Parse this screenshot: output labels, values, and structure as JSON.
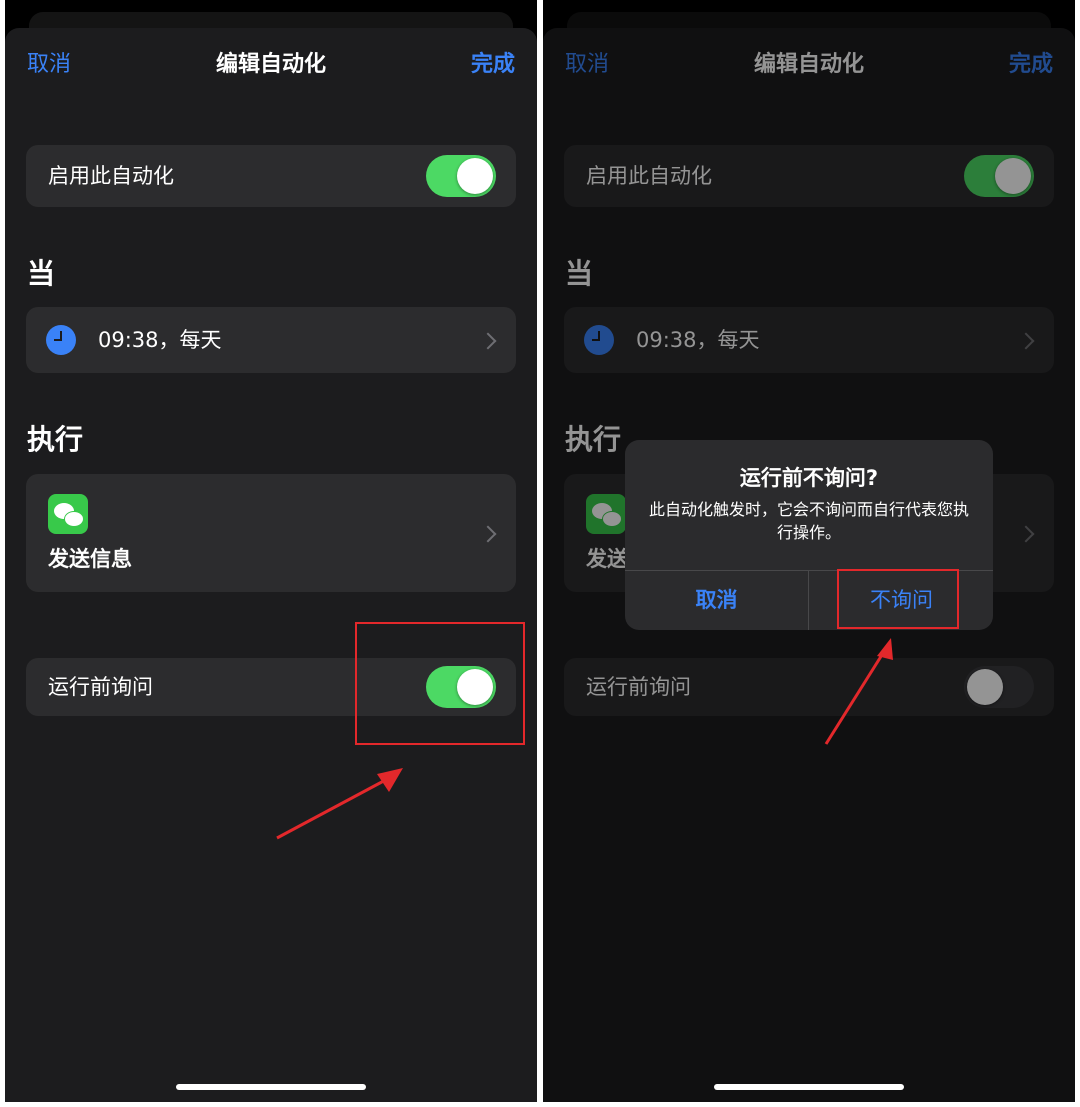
{
  "left_screen": {
    "nav": {
      "cancel": "取消",
      "title": "编辑自动化",
      "done": "完成"
    },
    "enable_row": {
      "label": "启用此自动化",
      "toggle_on": true
    },
    "when_section": {
      "header": "当",
      "trigger_text": "09:38，每天"
    },
    "do_section": {
      "header": "执行",
      "action_label": "发送信息",
      "app_icon": "wechat-icon"
    },
    "ask_row": {
      "label": "运行前询问",
      "toggle_on": true
    }
  },
  "right_screen": {
    "nav": {
      "cancel": "取消",
      "title": "编辑自动化",
      "done": "完成"
    },
    "enable_row": {
      "label": "启用此自动化",
      "toggle_on": true
    },
    "when_section": {
      "header": "当",
      "trigger_text": "09:38，每天"
    },
    "do_section": {
      "header": "执行",
      "action_label": "发送信息",
      "app_icon": "wechat-icon"
    },
    "ask_row": {
      "label": "运行前询问",
      "toggle_on": false
    },
    "alert": {
      "title": "运行前不询问?",
      "message": "此自动化触发时，它会不询问而自行代表您执行操作。",
      "cancel": "取消",
      "confirm": "不询问"
    }
  },
  "colors": {
    "accent_blue": "#3a82f7",
    "toggle_green": "#4cd964",
    "highlight_red": "#e3282b",
    "card_bg": "#2c2c2e",
    "sheet_bg": "#1c1c1e"
  }
}
